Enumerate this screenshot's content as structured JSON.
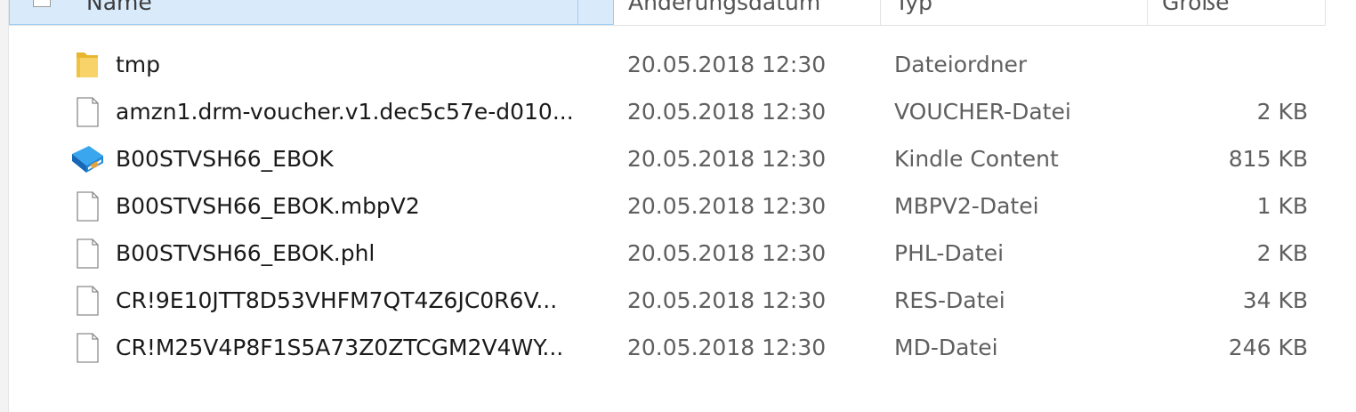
{
  "columns": {
    "name": "Name",
    "date": "Änderungsdatum",
    "type": "Typ",
    "size": "Größe"
  },
  "files": [
    {
      "name": "tmp",
      "date": "20.05.2018 12:30",
      "type": "Dateiordner",
      "size": "",
      "icon": "folder-icon"
    },
    {
      "name": "amzn1.drm-voucher.v1.dec5c57e-d010...",
      "date": "20.05.2018 12:30",
      "type": "VOUCHER-Datei",
      "size": "2 KB",
      "icon": "file-icon"
    },
    {
      "name": "B00STVSH66_EBOK",
      "date": "20.05.2018 12:30",
      "type": "Kindle Content",
      "size": "815 KB",
      "icon": "kindle-book-icon"
    },
    {
      "name": "B00STVSH66_EBOK.mbpV2",
      "date": "20.05.2018 12:30",
      "type": "MBPV2-Datei",
      "size": "1 KB",
      "icon": "file-icon"
    },
    {
      "name": "B00STVSH66_EBOK.phl",
      "date": "20.05.2018 12:30",
      "type": "PHL-Datei",
      "size": "2 KB",
      "icon": "file-icon"
    },
    {
      "name": "CR!9E10JTT8D53VHFM7QT4Z6JC0R6V...",
      "date": "20.05.2018 12:30",
      "type": "RES-Datei",
      "size": "34 KB",
      "icon": "file-icon"
    },
    {
      "name": "CR!M25V4P8F1S5A73Z0ZTCGM2V4WY...",
      "date": "20.05.2018 12:30",
      "type": "MD-Datei",
      "size": "246 KB",
      "icon": "file-icon"
    }
  ],
  "colors": {
    "selected_header_bg": "#d9ebfb",
    "selected_header_border": "#9fcdf3",
    "secondary_text": "#5f5f5f",
    "folder": "#f4c94a",
    "kindle_book": "#1e88d6"
  }
}
